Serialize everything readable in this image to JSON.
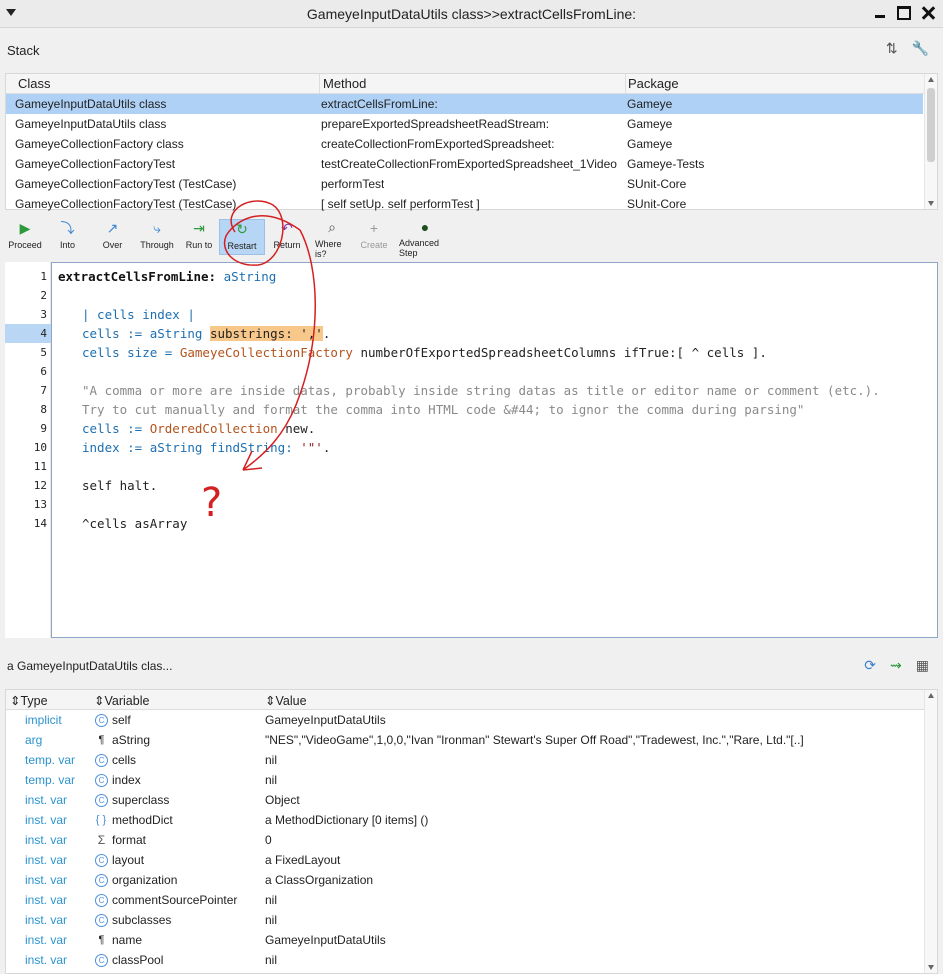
{
  "window": {
    "title": "GameyeInputDataUtils class>>extractCellsFromLine:"
  },
  "stack": {
    "label": "Stack",
    "columns": [
      "Class",
      "Method",
      "Package"
    ],
    "rows": [
      {
        "class": "GameyeInputDataUtils class",
        "method": "extractCellsFromLine:",
        "package": "Gameye"
      },
      {
        "class": "GameyeInputDataUtils class",
        "method": "prepareExportedSpreadsheetReadStream:",
        "package": "Gameye"
      },
      {
        "class": "GameyeCollectionFactory class",
        "method": "createCollectionFromExportedSpreadsheet:",
        "package": "Gameye"
      },
      {
        "class": "GameyeCollectionFactoryTest",
        "method": "testCreateCollectionFromExportedSpreadsheet_1Video",
        "package": "Gameye-Tests"
      },
      {
        "class": "GameyeCollectionFactoryTest (TestCase)",
        "method": "performTest",
        "package": "SUnit-Core"
      },
      {
        "class": "GameyeCollectionFactoryTest (TestCase)",
        "method": "[  self setUp.   self performTest ]",
        "package": "SUnit-Core"
      }
    ]
  },
  "toolbar": {
    "proceed": "Proceed",
    "into": "Into",
    "over": "Over",
    "through": "Through",
    "run_to": "Run to",
    "restart": "Restart",
    "return": "Return",
    "where_is": "Where is?",
    "create": "Create",
    "advanced_step": "Advanced Step"
  },
  "code": {
    "line_numbers": [
      "1",
      "2",
      "3",
      "4",
      "5",
      "6",
      "7",
      "8",
      "9",
      "10",
      "11",
      "12",
      "13",
      "14"
    ],
    "l1_sel": "extractCellsFromLine:",
    "l1_arg": "aString",
    "l3": "| cells index |",
    "l4_a": "cells := aString ",
    "l4_b": "substrings: ','",
    "l4_c": ".",
    "l5_a": "cells size = ",
    "l5_b": "GameyeCollectionFactory",
    "l5_c": " numberOfExportedSpreadsheetColumns ifTrue:[ ^ cells ].",
    "l7": "\"A comma or more are inside datas, probably inside string datas as title or editor name or comment (etc.).",
    "l8": "Try to cut manually and format the comma into HTML code &#44; to ignor the comma during parsing\"",
    "l9_a": "cells := ",
    "l9_b": "OrderedCollection",
    "l9_c": " new.",
    "l10_a": "index := aString findString: ",
    "l10_b": "'\"'",
    "l10_c": ".",
    "l12": "self halt.",
    "l14": "^cells asArray"
  },
  "inspector": {
    "label": "a GameyeInputDataUtils clas...",
    "columns": [
      "Type",
      "Variable",
      "Value"
    ],
    "rows": [
      {
        "type": "implicit",
        "icon": "C",
        "var": "self",
        "value": "GameyeInputDataUtils"
      },
      {
        "type": "arg",
        "icon": "¶",
        "var": "aString",
        "value": "\"NES\",\"VideoGame\",1,0,0,\"Ivan \"Ironman\" Stewart's Super Off Road\",\"Tradewest, Inc.\",\"Rare, Ltd.\"[..]"
      },
      {
        "type": "temp. var",
        "icon": "C",
        "var": "cells",
        "value": "nil"
      },
      {
        "type": "temp. var",
        "icon": "C",
        "var": "index",
        "value": "nil"
      },
      {
        "type": "inst. var",
        "icon": "C",
        "var": "superclass",
        "value": "Object"
      },
      {
        "type": "inst. var",
        "icon": "{ }",
        "var": "methodDict",
        "value": "a MethodDictionary [0 items] ()"
      },
      {
        "type": "inst. var",
        "icon": "Σ",
        "var": "format",
        "value": "0"
      },
      {
        "type": "inst. var",
        "icon": "C",
        "var": "layout",
        "value": "a FixedLayout"
      },
      {
        "type": "inst. var",
        "icon": "C",
        "var": "organization",
        "value": "a ClassOrganization"
      },
      {
        "type": "inst. var",
        "icon": "C",
        "var": "commentSourcePointer",
        "value": "nil"
      },
      {
        "type": "inst. var",
        "icon": "C",
        "var": "subclasses",
        "value": "nil"
      },
      {
        "type": "inst. var",
        "icon": "¶",
        "var": "name",
        "value": "GameyeInputDataUtils"
      },
      {
        "type": "inst. var",
        "icon": "C",
        "var": "classPool",
        "value": "nil"
      }
    ]
  },
  "annotation": {
    "mark": "?"
  },
  "colors": {
    "selection": "#aed1f5",
    "accent": "#2a93cf",
    "annotation": "#d42020"
  }
}
